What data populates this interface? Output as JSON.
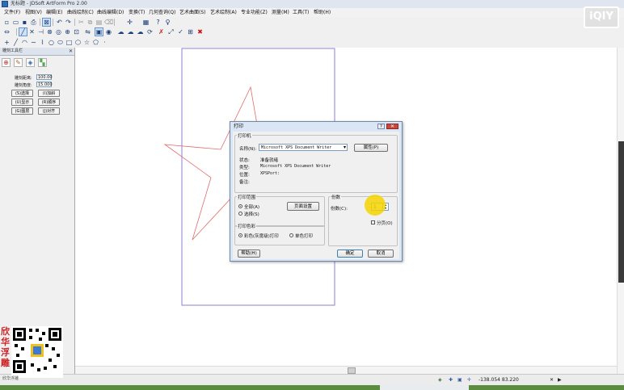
{
  "window": {
    "title": "无标题 - JDSoft ArtForm Pro 2.00"
  },
  "menu": [
    "文件(F)",
    "视图(V)",
    "编辑(E)",
    "曲线绘制(C)",
    "曲线编辑(D)",
    "变换(T)",
    "几何查询(Q)",
    "艺术曲面(S)",
    "艺术绘制(A)",
    "专业功能(Z)",
    "测量(M)",
    "工具(T)",
    "帮助(H)"
  ],
  "watermark": {
    "logo": "iQIY",
    "side_text": [
      "欣",
      "华",
      "浮",
      "雕"
    ],
    "caption": "欣华浮雕"
  },
  "left_panel": {
    "title": "雕刻工具栏",
    "fields": [
      {
        "label": "雕刻距离:",
        "value": "100.00"
      },
      {
        "label": "雕刻角度:",
        "value": "15.000"
      }
    ],
    "buttons": [
      "(S)选择",
      "(I)加斜",
      "(U)显示",
      "(R)顺序",
      "(G)图层",
      "(J)对齐"
    ]
  },
  "status": {
    "coords": "-138.054 83.220"
  },
  "dialog": {
    "title": "打印",
    "printer_group": "打印机",
    "name_label": "名称(N):",
    "name_value": "Microsoft XPS Document Writer",
    "properties_button": "属性(P)",
    "status_label": "状态:",
    "status_value": "准备就绪",
    "type_label": "类型:",
    "type_value": "Microsoft XPS Document Writer",
    "location_label": "位置:",
    "location_value": "XPSPort:",
    "comment_label": "备注:",
    "range_group": "打印范围",
    "range_all": "全部(A)",
    "range_select": "选择(S)",
    "page_setup_button": "页面设置",
    "copies_group": "份数",
    "copies_label": "份数(C):",
    "copies_value": "1",
    "collate_label": "分页(O)",
    "color_group": "打印色彩",
    "color_option": "彩色(灰度级)打印",
    "mono_option": "单色打印",
    "help_button": "帮助(H)",
    "ok_button": "确定",
    "cancel_button": "取消"
  },
  "colors": {
    "star": "#e26b6b",
    "page_border": "#8a82d6",
    "highlight": "#f4d400"
  }
}
